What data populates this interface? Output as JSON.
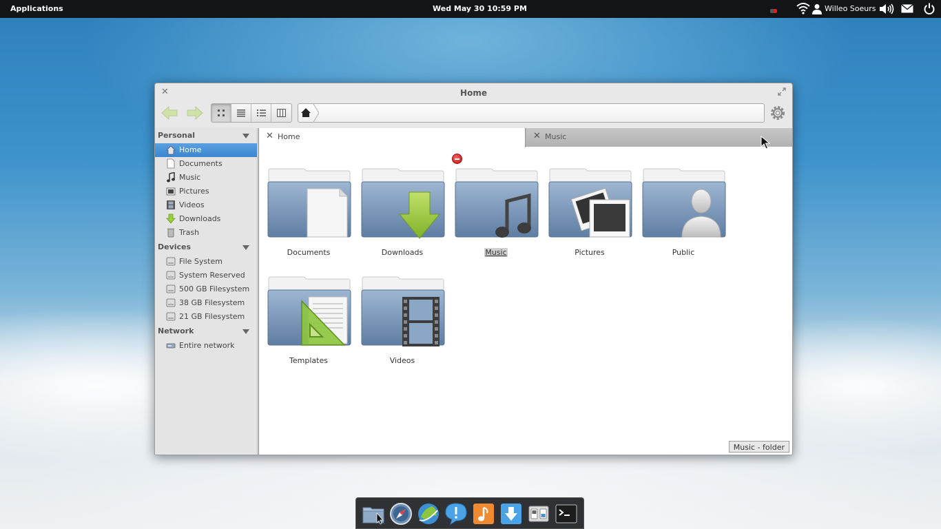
{
  "panel": {
    "applications_label": "Applications",
    "clock": "Wed May 30 10:59 PM",
    "user_name": "Willeo Soeurs",
    "icons": [
      "recording-indicator-icon",
      "wifi-icon",
      "user-icon",
      "volume-icon",
      "mail-icon",
      "power-icon"
    ]
  },
  "window": {
    "title": "Home",
    "toolbar": {
      "back_icon": "arrow-left-icon",
      "forward_icon": "arrow-right-icon",
      "views": [
        "icon-view",
        "list-view",
        "details-view",
        "column-view"
      ],
      "active_view": "icon-view",
      "path_icon": "home-icon",
      "settings_icon": "gear-icon"
    },
    "sidebar": {
      "sections": [
        {
          "title": "Personal",
          "items": [
            {
              "label": "Home",
              "icon": "home-icon",
              "selected": true
            },
            {
              "label": "Documents",
              "icon": "document-icon"
            },
            {
              "label": "Music",
              "icon": "music-icon"
            },
            {
              "label": "Pictures",
              "icon": "pictures-icon"
            },
            {
              "label": "Videos",
              "icon": "film-icon"
            },
            {
              "label": "Downloads",
              "icon": "download-icon"
            },
            {
              "label": "Trash",
              "icon": "trash-icon"
            }
          ]
        },
        {
          "title": "Devices",
          "items": [
            {
              "label": "File System",
              "icon": "drive-icon"
            },
            {
              "label": "System Reserved",
              "icon": "drive-icon"
            },
            {
              "label": "500 GB Filesystem",
              "icon": "drive-icon"
            },
            {
              "label": "38 GB Filesystem",
              "icon": "drive-icon"
            },
            {
              "label": "21 GB Filesystem",
              "icon": "drive-icon"
            }
          ]
        },
        {
          "title": "Network",
          "items": [
            {
              "label": "Entire network",
              "icon": "network-icon"
            }
          ]
        }
      ]
    },
    "tabs": [
      {
        "label": "Home",
        "active": true
      },
      {
        "label": "Music",
        "active": false
      }
    ],
    "folders": [
      {
        "label": "Documents",
        "emblem": "document"
      },
      {
        "label": "Downloads",
        "emblem": "download-arrow"
      },
      {
        "label": "Music",
        "emblem": "music-note",
        "renaming": true,
        "remove_emblem": true
      },
      {
        "label": "Pictures",
        "emblem": "photo"
      },
      {
        "label": "Public",
        "emblem": "person"
      },
      {
        "label": "Templates",
        "emblem": "set-square"
      },
      {
        "label": "Videos",
        "emblem": "film"
      }
    ],
    "status": "Music - folder"
  },
  "dock": {
    "items": [
      {
        "name": "files",
        "icon": "folder-icon",
        "running": true
      },
      {
        "name": "web-browser",
        "icon": "compass-icon",
        "running": true
      },
      {
        "name": "midori",
        "icon": "globe-icon"
      },
      {
        "name": "postler",
        "icon": "speech-bubble-icon"
      },
      {
        "name": "music-player",
        "icon": "music-note-icon"
      },
      {
        "name": "update-manager",
        "icon": "download-icon"
      },
      {
        "name": "settings",
        "icon": "switches-icon"
      },
      {
        "name": "terminal",
        "icon": "terminal-icon"
      }
    ]
  },
  "colors": {
    "panel_bg": "#121417",
    "selection": "#3d86cf",
    "folder_body": "#7d9cc0",
    "emblem_green": "#8cc63e"
  }
}
